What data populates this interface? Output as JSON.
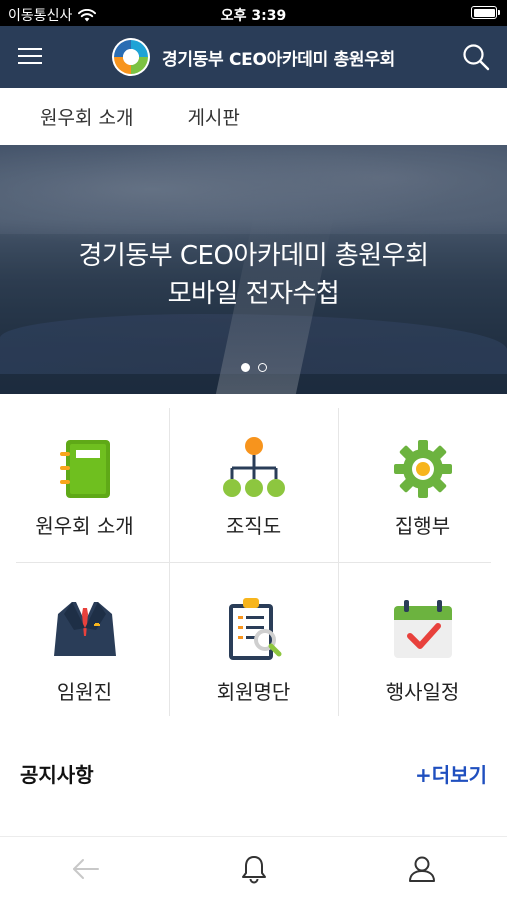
{
  "status_bar": {
    "carrier": "이동통신사",
    "time": "오후 3:39",
    "battery_level": 1.0
  },
  "header": {
    "title": "경기동부 CEO아카데미 총원우회",
    "menu_icon": "hamburger-menu-icon",
    "search_icon": "search-icon",
    "logo_colors": [
      "#1fa3d6",
      "#7cc242",
      "#f7941d",
      "#2a6db3"
    ],
    "background": "#2a3d58"
  },
  "tabs": [
    {
      "label": "원우회 소개"
    },
    {
      "label": "게시판"
    }
  ],
  "banner": {
    "line1": "경기동부 CEO아카데미 총원우회",
    "line2": "모바일 전자수첩",
    "slide_count": 2,
    "active_slide": 1
  },
  "menu": [
    {
      "label": "원우회 소개",
      "icon": "notebook-icon"
    },
    {
      "label": "조직도",
      "icon": "org-chart-icon"
    },
    {
      "label": "집행부",
      "icon": "gear-icon"
    },
    {
      "label": "임원진",
      "icon": "suit-icon"
    },
    {
      "label": "회원명단",
      "icon": "clipboard-search-icon"
    },
    {
      "label": "행사일정",
      "icon": "calendar-check-icon"
    }
  ],
  "notice": {
    "title": "공지사항",
    "more_label": "+더보기",
    "accent": "#1f4fbf"
  },
  "bottom_bar": {
    "back_icon": "back-arrow-icon",
    "bell_icon": "bell-icon",
    "profile_icon": "profile-icon"
  }
}
